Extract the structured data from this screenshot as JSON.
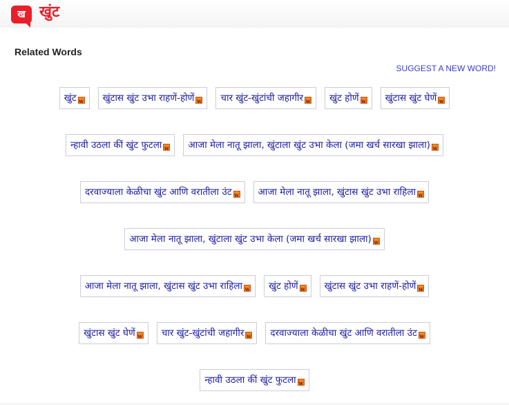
{
  "header": {
    "logo_text": "ख",
    "title": "खुंट",
    "brand_color": "#e8202a"
  },
  "related": {
    "title": "Related Words",
    "suggest_label": "SUGGEST A NEW WORD!",
    "link_color": "#1a1aa0",
    "icon": "w-icon",
    "rows": [
      [
        "खुंट",
        "खुंटास खुंट उभा राहणें-होणें",
        "चार खुंट-खुंटांची जहागीर",
        "खुंट होणें",
        "खुंटास खुंट घेणें"
      ],
      [
        "न्हावी उठला कीं खुंट फुटला",
        "आजा मेला नातू झाला, खुंटाला खुंट उभा केला (जमा खर्च सारखा झाला)"
      ],
      [
        "दरवाज्याला केळीचा खुंट आणि वरातीला उंट",
        "आजा मेला नातू झाला, खुंटास खुंट उभा राहिला"
      ],
      [
        "आजा मेला नातू झाला, खुंटाला खुंट उभा केला (जमा खर्च सारखा झाला)"
      ],
      [
        "आजा मेला नातू झाला, खुंटास खुंट उभा राहिला",
        "खुंट होणें",
        "खुंटास खुंट उभा राहणें-होणें"
      ],
      [
        "खुंटास खुंट घेणें",
        "चार खुंट-खुंटांची जहागीर",
        "दरवाज्याला केळीचा खुंट आणि वरातीला उंट"
      ],
      [
        "न्हावी उठला कीं खुंट फुटला"
      ]
    ]
  }
}
